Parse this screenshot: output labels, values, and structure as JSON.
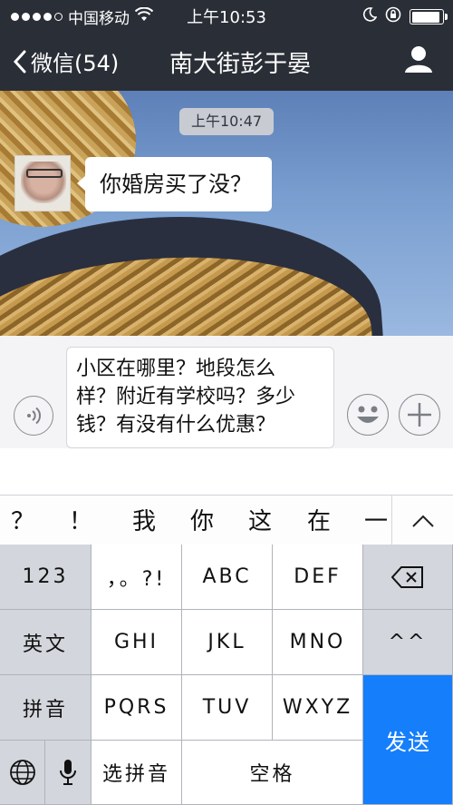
{
  "status_bar": {
    "carrier": "中国移动",
    "time": "上午10:53"
  },
  "nav": {
    "back_label": "微信(54)",
    "title": "南大街彭于晏"
  },
  "chat": {
    "timestamp": "上午10:47",
    "messages": [
      {
        "direction": "incoming",
        "text": "你婚房买了没？"
      }
    ]
  },
  "input": {
    "value": "小区在哪里？地段怎么样？附近有学校吗？多少钱？有没有什么优惠？",
    "lines": [
      "小区在哪里？地段怎么",
      "样？附近有学校吗？多少",
      "钱？有没有什么优惠？"
    ]
  },
  "keyboard": {
    "candidates": [
      "？",
      "！",
      "我",
      "你",
      "这",
      "在",
      "一"
    ],
    "rows": [
      [
        "123",
        "，。?!",
        "ABC",
        "DEF"
      ],
      [
        "英文",
        "GHI",
        "JKL",
        "MNO",
        "^^"
      ],
      [
        "拼音",
        "PQRS",
        "TUV",
        "WXYZ"
      ]
    ],
    "bottom": {
      "select_pinyin": "选拼音",
      "space": "空格"
    },
    "send": "发送"
  },
  "colors": {
    "nav_bg": "#2a2e36",
    "send_key": "#157efb",
    "keyboard_bg": "#b6b9c0"
  },
  "icons": [
    "signal-dots-icon",
    "wifi-icon",
    "moon-icon",
    "rotation-lock-icon",
    "battery-icon",
    "chevron-left-icon",
    "profile-icon",
    "voice-icon",
    "emoji-icon",
    "plus-icon",
    "chevron-up-icon",
    "backspace-icon",
    "globe-icon",
    "microphone-icon"
  ]
}
